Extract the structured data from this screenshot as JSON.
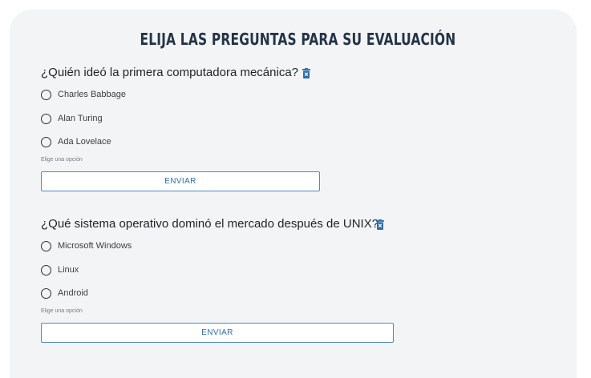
{
  "page_title": "ELIJA LAS PREGUNTAS PARA SU EVALUACIÓN",
  "accent_color": "#2f6eab",
  "questions": [
    {
      "text": "¿Quién ideó la primera computadora mecánica?",
      "delete_icon": "trash-icon",
      "options": [
        {
          "label": "Charles Babbage",
          "selected": false
        },
        {
          "label": "Alan Turing",
          "selected": false
        },
        {
          "label": "Ada Lovelace",
          "selected": false
        }
      ],
      "helper": "Elige una opción",
      "submit_label": "ENVIAR"
    },
    {
      "text": "¿Qué sistema operativo dominó el mercado después de UNIX?",
      "delete_icon": "trash-icon",
      "options": [
        {
          "label": "Microsoft Windows",
          "selected": false
        },
        {
          "label": "Linux",
          "selected": false
        },
        {
          "label": "Android",
          "selected": false
        }
      ],
      "helper": "Elige una opción",
      "submit_label": "ENVIAR"
    }
  ]
}
